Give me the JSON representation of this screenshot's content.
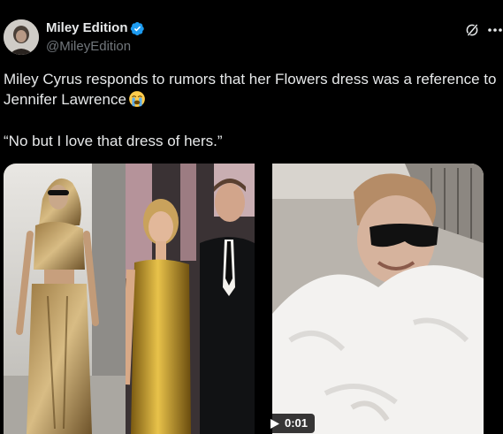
{
  "author": {
    "display_name": "Miley Edition",
    "handle": "@MileyEdition",
    "verified": true
  },
  "header_icons": [
    "grok-icon",
    "more-icon"
  ],
  "tweet": {
    "text_line": "Miley Cyrus responds to rumors that her Flowers dress was a reference to Jennifer Lawrence",
    "emoji": "loudly-crying-face",
    "quote": "“No but I love that dress of hers.”"
  },
  "media": {
    "type": "video",
    "duration": "0:01",
    "panels": [
      "gold-dress-photo",
      "red-carpet-photo",
      "white-fur-coat-clip"
    ]
  },
  "colors": {
    "background": "#000000",
    "text": "#e7e9ea",
    "secondary_text": "#71767b",
    "verified": "#1d9bf0"
  }
}
